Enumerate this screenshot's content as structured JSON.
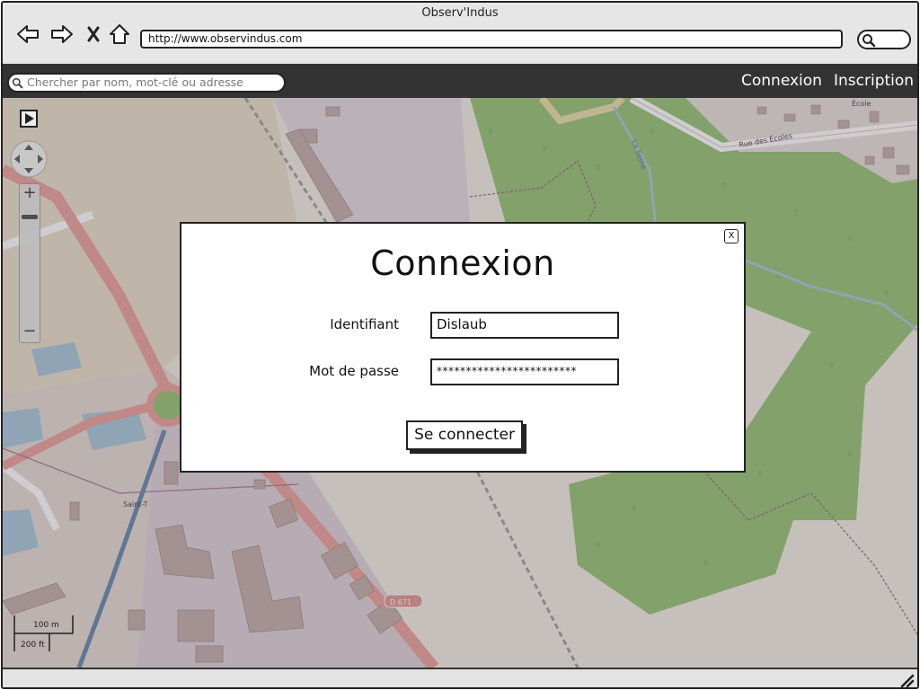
{
  "window": {
    "title": "Observ'Indus"
  },
  "browser": {
    "url": "http://www.observindus.com",
    "icons": [
      "back-arrow-icon",
      "forward-arrow-icon",
      "stop-icon",
      "home-icon",
      "search-icon"
    ]
  },
  "appbar": {
    "search_placeholder": "Chercher par nom, mot-clé ou adresse",
    "links": {
      "login": "Connexion",
      "signup": "Inscription"
    }
  },
  "map": {
    "zoom_in": "+",
    "zoom_out": "−",
    "scale_metric": "100 m",
    "scale_imperial": "200 ft",
    "labels": {
      "road": "D 671",
      "street": "Rue des Écoles",
      "school": "École",
      "river": "La Seine",
      "place": "Saint-T"
    }
  },
  "modal": {
    "close": "X",
    "title": "Connexion",
    "username_label": "Identifiant",
    "username_value": "Dislaub",
    "password_label": "Mot de passe",
    "password_value": "************************",
    "submit": "Se connecter"
  },
  "colors": {
    "appbar": "#333333",
    "forest": "#8cbf6a",
    "map_base": "#f0ece2",
    "road_red": "#e79a92",
    "water": "#9fc4d8",
    "overlay": "rgba(110,100,110,0.32)"
  }
}
